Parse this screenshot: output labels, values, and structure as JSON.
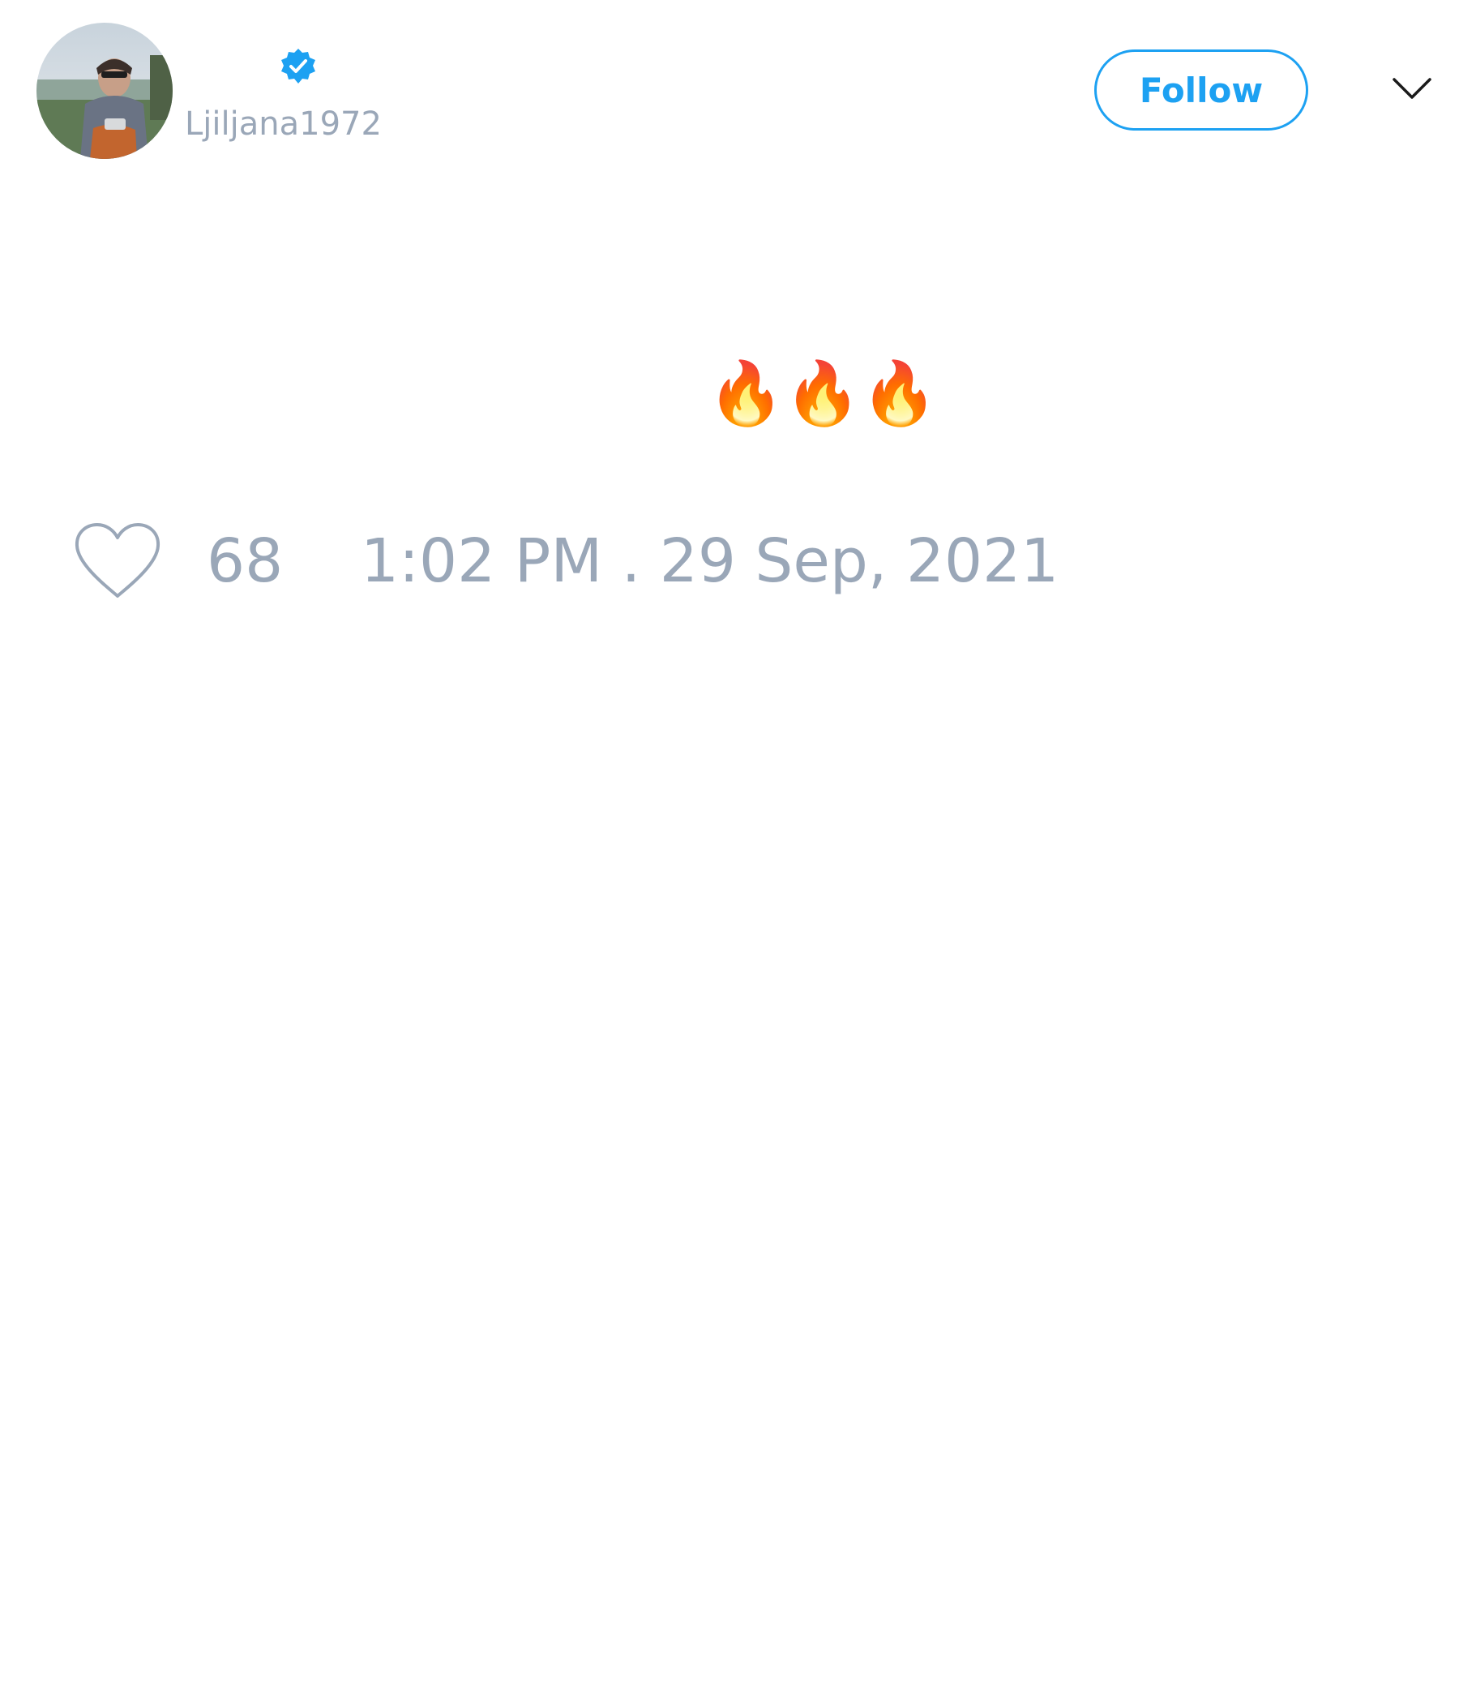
{
  "author": {
    "handle": "Ljiljana1972",
    "verified": true,
    "avatar_icon": "user-avatar-photo"
  },
  "header": {
    "follow_label": "Follow",
    "menu_icon": "chevron-down-icon"
  },
  "tweet": {
    "text": "🔥🔥🔥"
  },
  "footer": {
    "like_icon": "heart-icon",
    "like_count": "68",
    "timestamp": "1:02 PM . 29 Sep, 2021"
  },
  "colors": {
    "accent": "#1da1f2",
    "muted_text": "#9aa7b8",
    "background": "#ffffff"
  }
}
